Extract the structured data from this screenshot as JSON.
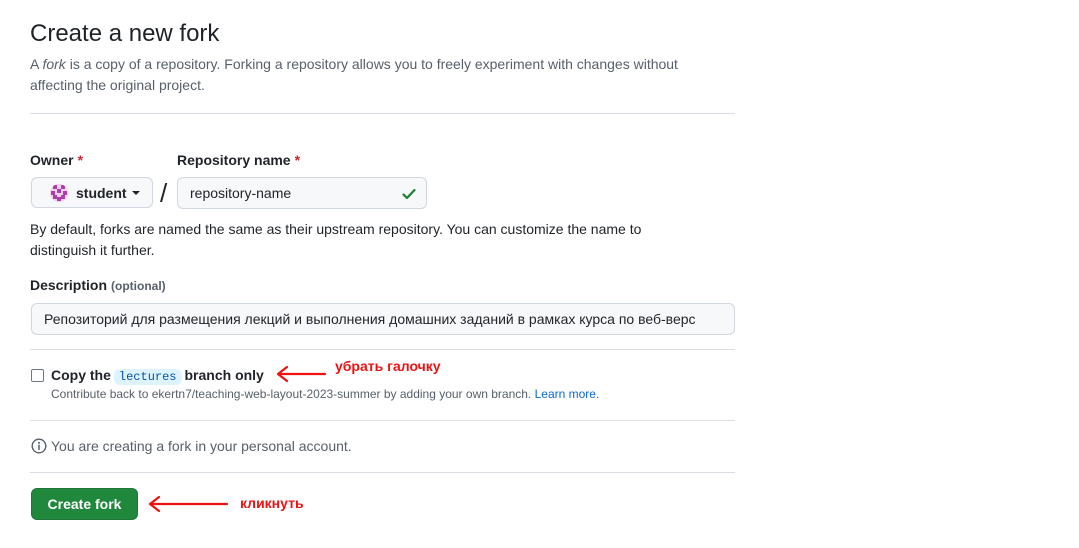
{
  "page": {
    "title": "Create a new fork",
    "intro_prefix": "A ",
    "intro_em": "fork",
    "intro_rest": " is a copy of a repository. Forking a repository allows you to freely experiment with changes without affecting the original project."
  },
  "owner": {
    "label": "Owner",
    "required_mark": "*",
    "value": "student"
  },
  "separator": "/",
  "repo_name": {
    "label": "Repository name",
    "required_mark": "*",
    "value": "repository-name"
  },
  "repo_help": "By default, forks are named the same as their upstream repository. You can customize the name to distinguish it further.",
  "description": {
    "label": "Description",
    "optional": "(optional)",
    "value": "Репозиторий для размещения лекций и выполнения домашних заданий в рамках курса по веб-верс"
  },
  "copy_branch": {
    "prefix": "Copy the",
    "branch": "lectures",
    "suffix": "branch only",
    "checked": false,
    "note": "Contribute back to ekertn7/teaching-web-layout-2023-summer by adding your own branch.",
    "learn_more": "Learn more."
  },
  "info_text": "You are creating a fork in your personal account.",
  "create_button": "Create fork",
  "annotations": {
    "uncheck": "убрать галочку",
    "click": "кликнуть"
  },
  "colors": {
    "primary_button": "#1f883d",
    "required": "#cf222e",
    "annotation": "#ee1111",
    "link": "#0969da",
    "success_check": "#1a7f37"
  }
}
